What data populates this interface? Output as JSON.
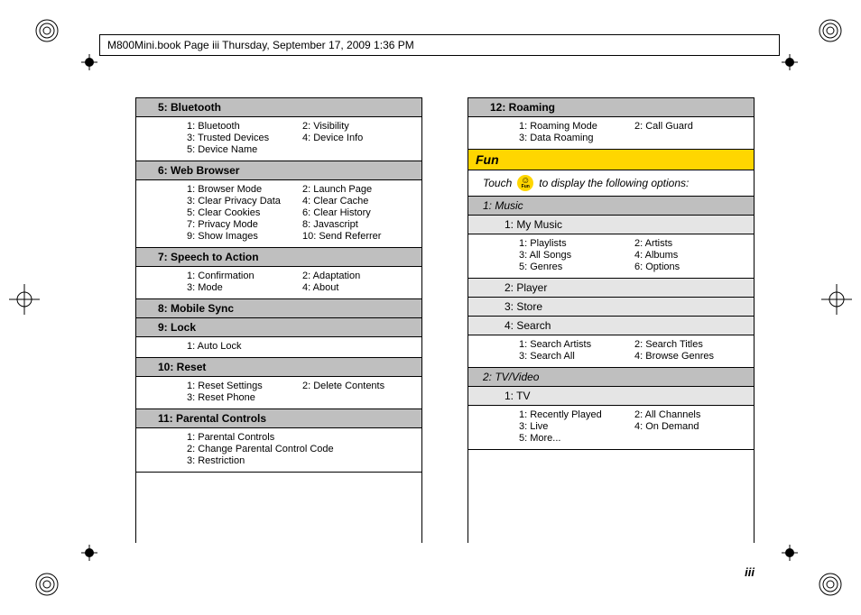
{
  "header": "M800Mini.book  Page iii  Thursday, September 17, 2009  1:36 PM",
  "page_number": "iii",
  "fun_icon_label": "Fun",
  "left_sections": [
    {
      "type": "l1",
      "title": "5: Bluetooth",
      "items": [
        "1: Bluetooth",
        "2: Visibility",
        "3: Trusted Devices",
        "4: Device Info",
        "5: Device Name"
      ]
    },
    {
      "type": "l1",
      "title": "6: Web Browser",
      "items": [
        "1: Browser Mode",
        "2: Launch Page",
        "3: Clear Privacy Data",
        "4: Clear Cache",
        "5: Clear Cookies",
        "6: Clear History",
        "7: Privacy Mode",
        "8: Javascript",
        "9: Show Images",
        "10: Send Referrer"
      ]
    },
    {
      "type": "l1",
      "title": "7: Speech to Action",
      "items": [
        "1: Confirmation",
        "2: Adaptation",
        "3: Mode",
        "4: About"
      ]
    },
    {
      "type": "l1",
      "title": "8: Mobile Sync"
    },
    {
      "type": "l1",
      "title": "9: Lock",
      "items_single": [
        "1: Auto Lock"
      ]
    },
    {
      "type": "l1",
      "title": "10: Reset",
      "items": [
        "1: Reset Settings",
        "2: Delete Contents",
        "3: Reset Phone"
      ]
    },
    {
      "type": "l1",
      "title": "11: Parental Controls",
      "items_single": [
        "1: Parental Controls",
        "2: Change Parental Control Code",
        "3: Restriction"
      ]
    }
  ],
  "right_sections": [
    {
      "type": "l1",
      "title": "12: Roaming",
      "items": [
        "1: Roaming Mode",
        "2: Call Guard",
        "3: Data Roaming"
      ]
    },
    {
      "type": "cat",
      "title": "Fun"
    },
    {
      "type": "note",
      "before": "Touch",
      "after": "to display the following options:"
    },
    {
      "type": "l1i",
      "title": "1: Music"
    },
    {
      "type": "l2",
      "title": "1: My Music",
      "items": [
        "1: Playlists",
        "2: Artists",
        "3: All Songs",
        "4: Albums",
        "5: Genres",
        "6: Options"
      ]
    },
    {
      "type": "l2",
      "title": "2: Player"
    },
    {
      "type": "l2",
      "title": "3: Store"
    },
    {
      "type": "l2",
      "title": "4: Search",
      "items": [
        "1: Search Artists",
        "2: Search Titles",
        "3: Search All",
        "4: Browse Genres"
      ]
    },
    {
      "type": "l1i",
      "title": "2: TV/Video"
    },
    {
      "type": "l2",
      "title": "1: TV",
      "items": [
        "1: Recently Played",
        "2: All Channels",
        "3: Live",
        "4: On Demand",
        "5: More..."
      ]
    }
  ]
}
